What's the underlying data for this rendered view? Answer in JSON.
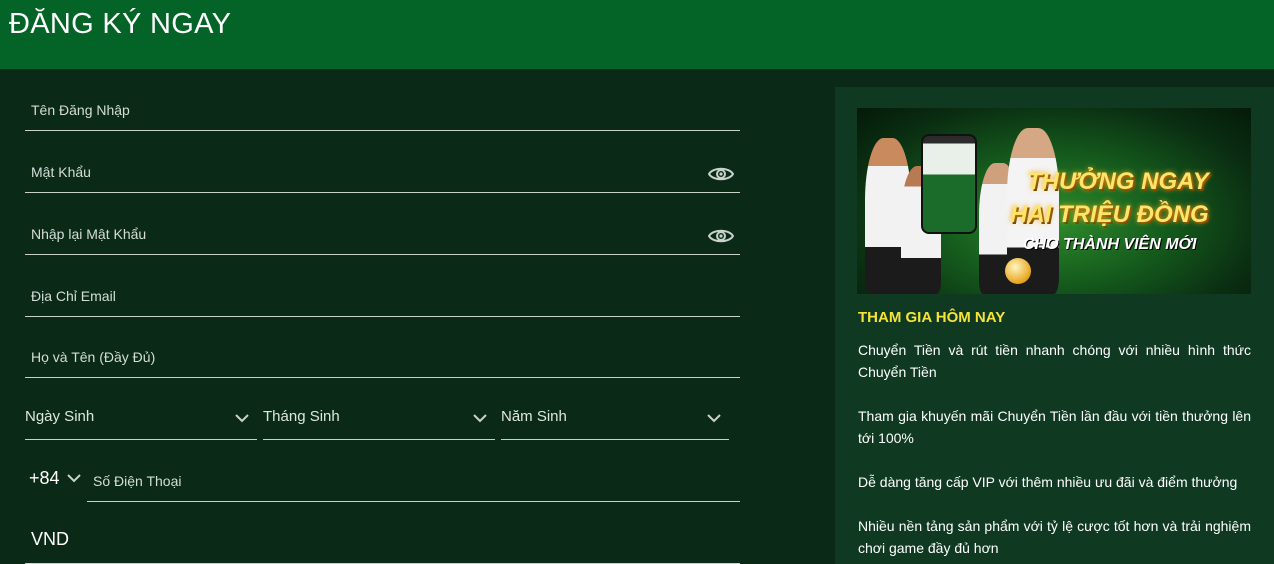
{
  "header": {
    "title": "ĐĂNG KÝ NGAY"
  },
  "form": {
    "username_placeholder": "Tên Đăng Nhập",
    "password_placeholder": "Mật Khẩu",
    "confirm_password_placeholder": "Nhập lại Mật Khẩu",
    "email_placeholder": "Địa Chỉ Email",
    "fullname_placeholder": "Họ và Tên (Đầy Đủ)",
    "birth_day_label": "Ngày Sinh",
    "birth_month_label": "Tháng Sinh",
    "birth_year_label": "Năm Sinh",
    "phone_prefix": "+84",
    "phone_placeholder": "Số Điện Thoại",
    "currency": "VND"
  },
  "side": {
    "banner": {
      "line1": "THƯỞNG NGAY",
      "line2": "HAI TRIỆU ĐỒNG",
      "line3": "CHO THÀNH VIÊN MỚI"
    },
    "title": "THAM GIA HÔM NAY",
    "paragraphs": [
      "Chuyển Tiền và rút tiền nhanh chóng với nhiều hình thức Chuyển Tiền",
      "Tham gia khuyến mãi Chuyển Tiền lần đầu với tiền thưởng lên tới 100%",
      "Dễ dàng tăng cấp VIP với thêm nhiều ưu đãi và điểm thưởng",
      "Nhiều nền tảng sản phẩm với tỷ lệ cược tốt hơn và trải nghiệm chơi game đầy đủ hơn"
    ]
  },
  "colors": {
    "header_bg": "#046427",
    "page_bg": "#0a2a17",
    "side_bg": "#0f3a21",
    "accent_yellow": "#f5e33a"
  },
  "icons": {
    "password_toggle": "eye-icon",
    "dropdown": "chevron-down-icon"
  }
}
